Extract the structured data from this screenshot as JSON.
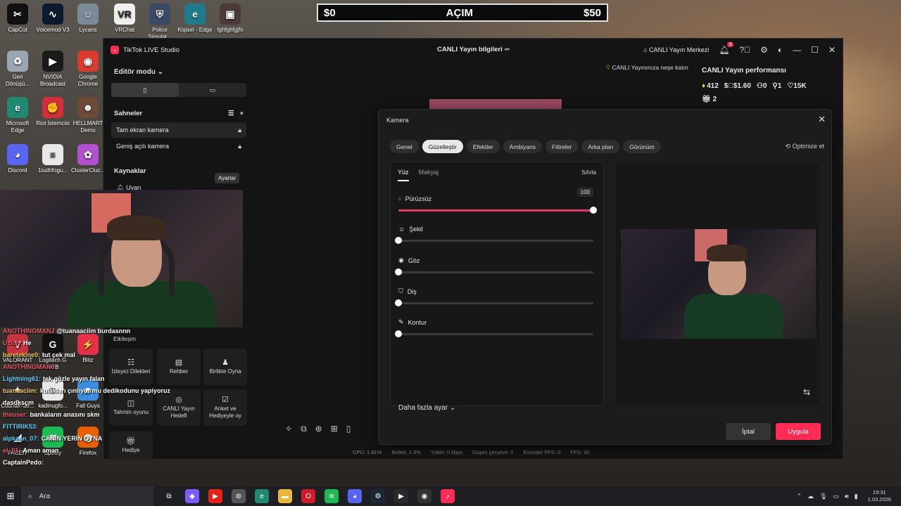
{
  "desktop": {
    "icons": [
      {
        "label": "CapCut",
        "icon": "capcut-icon",
        "color": "#111111",
        "glyph": "✂"
      },
      {
        "label": "Voicemod V3",
        "icon": "voicemod-icon",
        "color": "#0b1a2e",
        "glyph": "∿"
      },
      {
        "label": "Lycans",
        "icon": "lycans-icon",
        "color": "#7a8a99",
        "glyph": "☺"
      },
      {
        "label": "VRChat",
        "icon": "vrchat-icon",
        "color": "#f0f0f0",
        "glyph": "VR"
      },
      {
        "label": "Police Simulat...",
        "icon": "police-sim-icon",
        "color": "#3a4a66",
        "glyph": "⛨"
      },
      {
        "label": "Kişisel - Edge",
        "icon": "edge-icon",
        "color": "#1f7a8c",
        "glyph": "e"
      },
      {
        "label": "fghfghfgjfn",
        "icon": "folder-image-icon",
        "color": "#4a3a3a",
        "glyph": "▣"
      },
      {
        "label": "Geri Dönüşü...",
        "icon": "recycle-bin-icon",
        "color": "#9aa7b0",
        "glyph": "♻"
      },
      {
        "label": "NVIDIA Broadcast",
        "icon": "nvidia-icon",
        "color": "#1a1a1a",
        "glyph": "▶"
      },
      {
        "label": "Google Chrome",
        "icon": "chrome-icon",
        "color": "#d93b2f",
        "glyph": "◉"
      },
      {
        "label": "Microsoft Edge",
        "icon": "ms-edge-icon",
        "color": "#1f8a70",
        "glyph": "e"
      },
      {
        "label": "Riot İstemcisi",
        "icon": "riot-icon",
        "color": "#d1303a",
        "glyph": "✊"
      },
      {
        "label": "HELLMART Demo",
        "icon": "hellmart-icon",
        "color": "#6b4a3a",
        "glyph": "☻"
      },
      {
        "label": "Discord",
        "icon": "discord-icon",
        "color": "#5865f2",
        "glyph": "◕"
      },
      {
        "label": "1iudhfogu...",
        "icon": "text-file-icon",
        "color": "#e8e8e8",
        "glyph": "≡"
      },
      {
        "label": "ClusterCluc...",
        "icon": "cluster-icon",
        "color": "#b34fd1",
        "glyph": "✿"
      },
      {
        "label": "VALORANT",
        "icon": "valorant-icon",
        "color": "#c7323f",
        "glyph": "V"
      },
      {
        "label": "Logitech G HUB",
        "icon": "logitech-icon",
        "color": "#111111",
        "glyph": "G"
      },
      {
        "label": "Blitz",
        "icon": "blitz-icon",
        "color": "#e6304a",
        "glyph": "⚡"
      },
      {
        "label": "Counter-Str...",
        "icon": "cs-icon",
        "color": "#333333",
        "glyph": "✦"
      },
      {
        "label": "kadinugfo...",
        "icon": "text-file-icon",
        "color": "#e8e8e8",
        "glyph": "≡"
      },
      {
        "label": "Fall Guys",
        "icon": "fallguys-icon",
        "color": "#3b8de0",
        "glyph": "☻"
      },
      {
        "label": "FACEIT",
        "icon": "faceit-icon",
        "color": "#222222",
        "glyph": "◢"
      },
      {
        "label": "Spotify",
        "icon": "spotify-icon",
        "color": "#1db954",
        "glyph": "≋"
      },
      {
        "label": "Firefox",
        "icon": "firefox-icon",
        "color": "#e66000",
        "glyph": "◍"
      }
    ]
  },
  "donation_bar": {
    "left": "$0",
    "center": "AÇIM",
    "right": "$50"
  },
  "app": {
    "title": "TikTok LIVE Studio",
    "center_title": "CANLI Yayın bilgileri",
    "live_center": "CANLI Yayın Merkezi",
    "notification_count": "3",
    "editor_mode": "Editör modu",
    "scenes_title": "Sahneler",
    "scenes": [
      "Tam ekran kamera",
      "Geniş açılı kamera"
    ],
    "sources_title": "Kaynaklar",
    "sources": [
      "Uyarı"
    ],
    "tooltip": "Ayarlar",
    "interaction_title": "Etkileşim",
    "interaction_tiles": [
      {
        "label": "İzleyici Dilekleri"
      },
      {
        "label": "Rehber"
      },
      {
        "label": "Birlikte Oyna"
      },
      {
        "label": "Tahmin oyunu"
      },
      {
        "label": "CANLI Yayın Hedefi"
      },
      {
        "label": "Anket ve Hediyeyle oy"
      },
      {
        "label": "Hediye"
      }
    ],
    "notice": "CANLI Yayınınıza neşe katın",
    "performance": {
      "title": "CANLI Yayın performansı",
      "diamonds": "412",
      "earnings": "$1.60",
      "viewers": "0",
      "followers": "1",
      "likes": "15K",
      "gifts": "2"
    },
    "status": {
      "cpu": "CPU: 1.81%",
      "memory": "Bellek: 1.9%",
      "upload": "Yükle: 0 kbps",
      "dropped": "Düşen çerçeve: 0",
      "encoder": "Encoder FPS: 0",
      "fps": "FPS: 30"
    }
  },
  "dialog": {
    "title": "Kamera",
    "tabs": [
      "Genel",
      "Güzelleştir",
      "Efektler",
      "Ambiyans",
      "Filtreler",
      "Arka plan",
      "Görünüm"
    ],
    "active_tab": "Güzelleştir",
    "optimize": "Optimize et",
    "subtabs": [
      "Yüz",
      "Makyaj"
    ],
    "reset": "Sıfırla",
    "sliders": [
      {
        "label": "Pürüzsüz",
        "icon": "droplet-icon",
        "value": 100
      },
      {
        "label": "Şekil",
        "icon": "face-shape-icon",
        "value": 0
      },
      {
        "label": "Göz",
        "icon": "eye-icon",
        "value": 0
      },
      {
        "label": "Diş",
        "icon": "tooth-icon",
        "value": 0
      },
      {
        "label": "Kontur",
        "icon": "contour-icon",
        "value": 0
      }
    ],
    "slider_value_label": "100",
    "more_settings": "Daha fazla ayar",
    "cancel": "İptal",
    "apply": "Uygula"
  },
  "chat": [
    {
      "user": "ANOTHINGMANJ",
      "text": "@tuanaaciim burdasnnn",
      "color": "#e85a6a"
    },
    {
      "user": "Uzilsy",
      "text": "He",
      "color": "#e85a6a"
    },
    {
      "user": "baretekine0:",
      "text": "tut çek mal",
      "color": "#f2c94c"
    },
    {
      "user": "ANOTHINGMANJ",
      "text": "",
      "color": "#e85a6a"
    },
    {
      "user": "Lightning61:",
      "text": "tek gözle yayın falan",
      "color": "#5ad1ff"
    },
    {
      "user": "tuanaaciim:",
      "text": "kulakları çınlıyor mu dedikodunu yapiyoruz",
      "color": "#f2c94c"
    },
    {
      "user": "dasdksçm",
      "text": "",
      "color": "#ffffff"
    },
    {
      "user": "theuser:",
      "text": "bankaların anasını skm",
      "color": "#e85a6a"
    },
    {
      "user": "FITTIRIK53:",
      "text": "",
      "color": "#5ad1ff"
    },
    {
      "user": "alpkaan_07:",
      "text": "CANIN YERİN OYNA",
      "color": "#5ad1ff"
    },
    {
      "user": "el_01:",
      "text": "Aman aman",
      "color": "#e85a6a"
    },
    {
      "user": "CaptainPedo:",
      "text": "",
      "color": "#ffffff"
    }
  ],
  "taskbar": {
    "search": "Ara",
    "time": "19:31",
    "date": "1.03.2026"
  }
}
